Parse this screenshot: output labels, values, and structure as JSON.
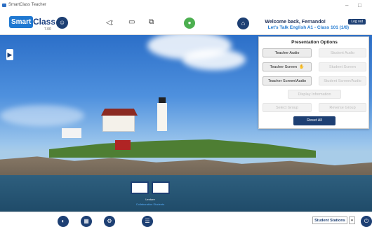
{
  "window": {
    "title": "SmartClass Teacher",
    "controls": [
      "–",
      "□"
    ]
  },
  "logo": {
    "brand_part1": "Smart",
    "brand_part2": "Class",
    "version": "7.00"
  },
  "header": {
    "welcome": "Welcome back, Fernando!",
    "class_info": "Let's Talk English A1 - Class 101 (1/6)",
    "logout_label": "Log out"
  },
  "presentation_panel": {
    "title": "Presentation Options",
    "buttons": [
      {
        "label": "Teacher Audio",
        "enabled": true
      },
      {
        "label": "Student Audio",
        "enabled": false
      },
      {
        "label": "Teacher Screen",
        "enabled": true,
        "icon": "hand-icon"
      },
      {
        "label": "Student Screen",
        "enabled": false
      },
      {
        "label": "Teacher Screen/Audio",
        "enabled": true
      },
      {
        "label": "Student Screen/Audio",
        "enabled": false
      },
      {
        "label": "Display Information",
        "enabled": false
      },
      {
        "label": "Select Group",
        "enabled": false
      },
      {
        "label": "Reverse Group",
        "enabled": false
      }
    ],
    "reset_label": "Reset All"
  },
  "stations": {
    "label": "Lecture",
    "sublabel": "Collaboration Students"
  },
  "bottom": {
    "stations_dropdown": "Student Stations",
    "dropdown_arrow": "▾"
  },
  "colors": {
    "accent": "#1d3f73",
    "brand": "#1f78d1",
    "mic": "#4caf50",
    "reset": "#1d3f73"
  }
}
